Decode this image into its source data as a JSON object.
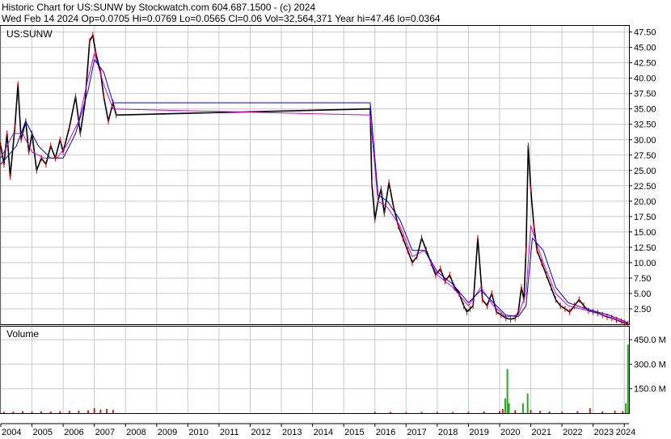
{
  "header": {
    "line1": "Historic Chart for US:SUNW by Stockwatch.com 604.687.1500 - (c) 2024",
    "line2": "Wed Feb 14 2024   Op=0.0705   Hi=0.0769   Lo=0.0565   Cl=0.06   Vol=32,564,371   Year hi=47.46   lo=0.0364"
  },
  "colors": {
    "price": "#000000",
    "close": "#d40000",
    "ma_short": "#cc00cc",
    "ma_long": "#0000cc",
    "volume": "#22aa22",
    "volume_down": "#cc2222",
    "grid": "#c8c8c8",
    "border": "#000000"
  },
  "chart_data": [
    {
      "type": "line",
      "title": "US:SUNW",
      "ylim": [
        0,
        48.5
      ],
      "yticks": [
        2.5,
        5,
        7.5,
        10,
        12.5,
        15,
        17.5,
        20,
        22.5,
        25,
        27.5,
        30,
        32.5,
        35,
        37.5,
        40,
        42.5,
        45,
        47.5
      ],
      "ytick_labels": [
        "2.50",
        "5.00",
        "7.50",
        "10.00",
        "12.50",
        "15.00",
        "17.50",
        "20.00",
        "22.50",
        "25.00",
        "27.50",
        "30.00",
        "32.50",
        "35.00",
        "37.50",
        "40.00",
        "42.50",
        "45.00",
        "47.50"
      ],
      "xlim": [
        2004.0,
        2024.15
      ],
      "xticks": [
        2004,
        2005,
        2006,
        2007,
        2008,
        2009,
        2010,
        2011,
        2012,
        2013,
        2014,
        2015,
        2016,
        2017,
        2018,
        2019,
        2020,
        2021,
        2022,
        2023,
        2024
      ],
      "xtick_labels": [
        "2004",
        "2005",
        "2006",
        "2007",
        "2008",
        "2009",
        "2010",
        "2011",
        "2012",
        "2013",
        "2014",
        "2015",
        "2016",
        "2017",
        "2018",
        "2019",
        "2020",
        "2021",
        "2022",
        "2023",
        "2024"
      ],
      "series": [
        {
          "role": "price",
          "x": [
            2004.0,
            2004.1,
            2004.2,
            2004.3,
            2004.45,
            2004.55,
            2004.65,
            2004.8,
            2004.9,
            2005.0,
            2005.15,
            2005.3,
            2005.45,
            2005.6,
            2005.75,
            2005.9,
            2006.0,
            2006.2,
            2006.4,
            2006.55,
            2006.7,
            2006.85,
            2006.95,
            2007.05,
            2007.2,
            2007.3,
            2007.45,
            2007.6,
            2007.7,
            2015.85,
            2015.9,
            2016.0,
            2016.1,
            2016.2,
            2016.3,
            2016.45,
            2016.6,
            2016.75,
            2016.9,
            2017.05,
            2017.2,
            2017.35,
            2017.5,
            2017.65,
            2017.8,
            2017.95,
            2018.1,
            2018.25,
            2018.4,
            2018.55,
            2018.7,
            2018.85,
            2018.95,
            2019.05,
            2019.15,
            2019.3,
            2019.45,
            2019.6,
            2019.75,
            2019.9,
            2020.05,
            2020.2,
            2020.35,
            2020.5,
            2020.6,
            2020.7,
            2020.78,
            2020.85,
            2020.92,
            2021.0,
            2021.1,
            2021.2,
            2021.35,
            2021.5,
            2021.65,
            2021.8,
            2021.95,
            2022.1,
            2022.25,
            2022.4,
            2022.55,
            2022.7,
            2022.85,
            2023.0,
            2023.15,
            2023.3,
            2023.45,
            2023.6,
            2023.75,
            2023.9,
            2024.0,
            2024.12
          ],
          "values": [
            29,
            26,
            31,
            24,
            32,
            39,
            30,
            33,
            28,
            31,
            25,
            27,
            26,
            29,
            27,
            30,
            28,
            32,
            37,
            31,
            36,
            46,
            47,
            44,
            41,
            37,
            33,
            36,
            34,
            35,
            23,
            17,
            20,
            22,
            18,
            23,
            19,
            16,
            14,
            12,
            10,
            11,
            14,
            12,
            10,
            8,
            9,
            7,
            8,
            6,
            5,
            3,
            2,
            2.5,
            3,
            14,
            4,
            3,
            5,
            2,
            1.5,
            1,
            0.8,
            1,
            2,
            6,
            4,
            12,
            29,
            22,
            16,
            12,
            10,
            8,
            6,
            4,
            3,
            2.5,
            2,
            3,
            4,
            3,
            2.2,
            2,
            1.8,
            1.5,
            1.2,
            1,
            0.7,
            0.4,
            0.2,
            0.06
          ]
        },
        {
          "role": "ma_short",
          "x": [
            2004.0,
            2004.4,
            2004.7,
            2005.0,
            2005.4,
            2005.8,
            2006.1,
            2006.5,
            2006.8,
            2007.0,
            2007.3,
            2007.6,
            2015.85,
            2016.1,
            2016.4,
            2016.8,
            2017.2,
            2017.6,
            2018.0,
            2018.5,
            2019.0,
            2019.4,
            2019.8,
            2020.2,
            2020.6,
            2020.85,
            2021.0,
            2021.4,
            2021.8,
            2022.2,
            2022.6,
            2023.0,
            2023.5,
            2024.0,
            2024.12
          ],
          "values": [
            27,
            31,
            31,
            28,
            27,
            27,
            29,
            33,
            40,
            44,
            39,
            35,
            34,
            20,
            19,
            16,
            11,
            12,
            8,
            6,
            3,
            6,
            3,
            1.2,
            1.5,
            5,
            16,
            10,
            5,
            3,
            2.5,
            2,
            1.2,
            0.3,
            0.1
          ]
        },
        {
          "role": "ma_long",
          "x": [
            2004.0,
            2004.5,
            2004.8,
            2005.2,
            2005.6,
            2006.0,
            2006.4,
            2006.8,
            2007.0,
            2007.3,
            2007.6,
            2015.85,
            2016.1,
            2016.4,
            2016.8,
            2017.2,
            2017.6,
            2018.0,
            2018.5,
            2019.0,
            2019.4,
            2019.8,
            2020.2,
            2020.6,
            2020.85,
            2021.05,
            2021.4,
            2021.8,
            2022.2,
            2022.6,
            2023.0,
            2023.5,
            2024.0,
            2024.12
          ],
          "values": [
            26,
            29,
            33,
            29,
            27,
            27,
            31,
            38,
            43,
            41,
            36,
            36,
            21,
            20,
            17,
            12,
            12,
            8.5,
            6.5,
            3.5,
            5.5,
            3.5,
            1.5,
            1.2,
            3,
            14,
            12,
            6,
            3.5,
            2.8,
            2.2,
            1.5,
            0.5,
            0.2
          ]
        }
      ]
    },
    {
      "type": "bar",
      "title": "Volume",
      "ylim": [
        0,
        530
      ],
      "yticks": [
        150,
        300,
        450
      ],
      "ytick_labels": [
        "150.0 M",
        "300.0 M",
        "450.0 M"
      ],
      "xlim": [
        2004.0,
        2024.15
      ],
      "x": [
        2004.1,
        2004.4,
        2004.7,
        2005.0,
        2005.3,
        2005.6,
        2005.9,
        2006.2,
        2006.5,
        2006.8,
        2007.0,
        2007.2,
        2007.4,
        2007.6,
        2016.0,
        2016.5,
        2017.0,
        2017.5,
        2018.0,
        2018.5,
        2019.0,
        2019.5,
        2020.0,
        2020.1,
        2020.18,
        2020.25,
        2020.3,
        2020.5,
        2020.75,
        2020.9,
        2021.0,
        2021.3,
        2021.6,
        2022.0,
        2022.5,
        2022.9,
        2023.3,
        2023.7,
        2023.95,
        2024.05,
        2024.12
      ],
      "values": [
        8,
        10,
        12,
        9,
        11,
        10,
        12,
        14,
        15,
        18,
        30,
        22,
        26,
        20,
        8,
        7,
        6,
        8,
        7,
        6,
        8,
        10,
        12,
        25,
        90,
        270,
        60,
        18,
        60,
        120,
        20,
        14,
        10,
        8,
        12,
        30,
        10,
        14,
        12,
        60,
        420
      ]
    }
  ]
}
